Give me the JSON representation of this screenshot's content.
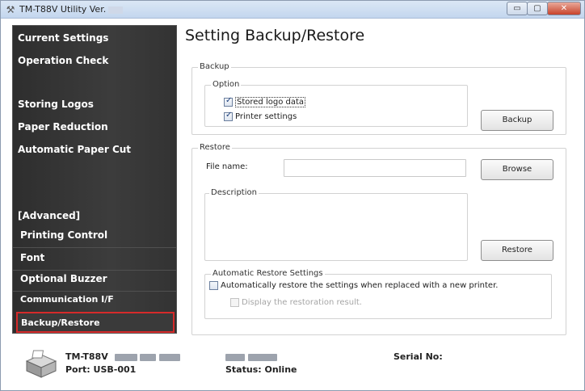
{
  "window": {
    "title": "TM-T88V Utility Ver.",
    "app_icon": "tool-icon",
    "buttons": {
      "minimize": "▭",
      "maximize": "▢",
      "close": "✕"
    }
  },
  "sidebar": {
    "items": [
      {
        "label": "Current Settings"
      },
      {
        "label": "Operation Check"
      },
      {
        "label": "Storing Logos"
      },
      {
        "label": "Paper Reduction"
      },
      {
        "label": "Automatic Paper Cut"
      }
    ],
    "advanced_header": "[Advanced]",
    "advanced_items": [
      {
        "label": "Printing Control"
      },
      {
        "label": "Font"
      },
      {
        "label": "Optional Buzzer"
      },
      {
        "label": "Communication I/F"
      },
      {
        "label": "Backup/Restore",
        "selected": true
      }
    ],
    "selected_border_color": "#d62a2a"
  },
  "main": {
    "title": "Setting Backup/Restore",
    "backup": {
      "group_label": "Backup",
      "option_label": "Option",
      "stored_logo_label": "Stored logo data",
      "stored_logo_checked": true,
      "printer_settings_label": "Printer settings",
      "printer_settings_checked": true,
      "backup_button": "Backup"
    },
    "restore": {
      "group_label": "Restore",
      "file_name_label": "File name:",
      "file_name_value": "",
      "browse_button": "Browse",
      "description_label": "Description",
      "restore_button": "Restore",
      "auto_group_label": "Automatic Restore Settings",
      "auto_restore_label": "Automatically restore the settings when replaced with a new printer.",
      "auto_restore_checked": false,
      "display_result_label": "Display the restoration result.",
      "display_result_checked": false
    }
  },
  "footer": {
    "model": "TM-T88V",
    "port": "Port: USB-001",
    "status": "Status: Online",
    "serial_label": "Serial No:",
    "printer_icon": "printer-icon"
  }
}
